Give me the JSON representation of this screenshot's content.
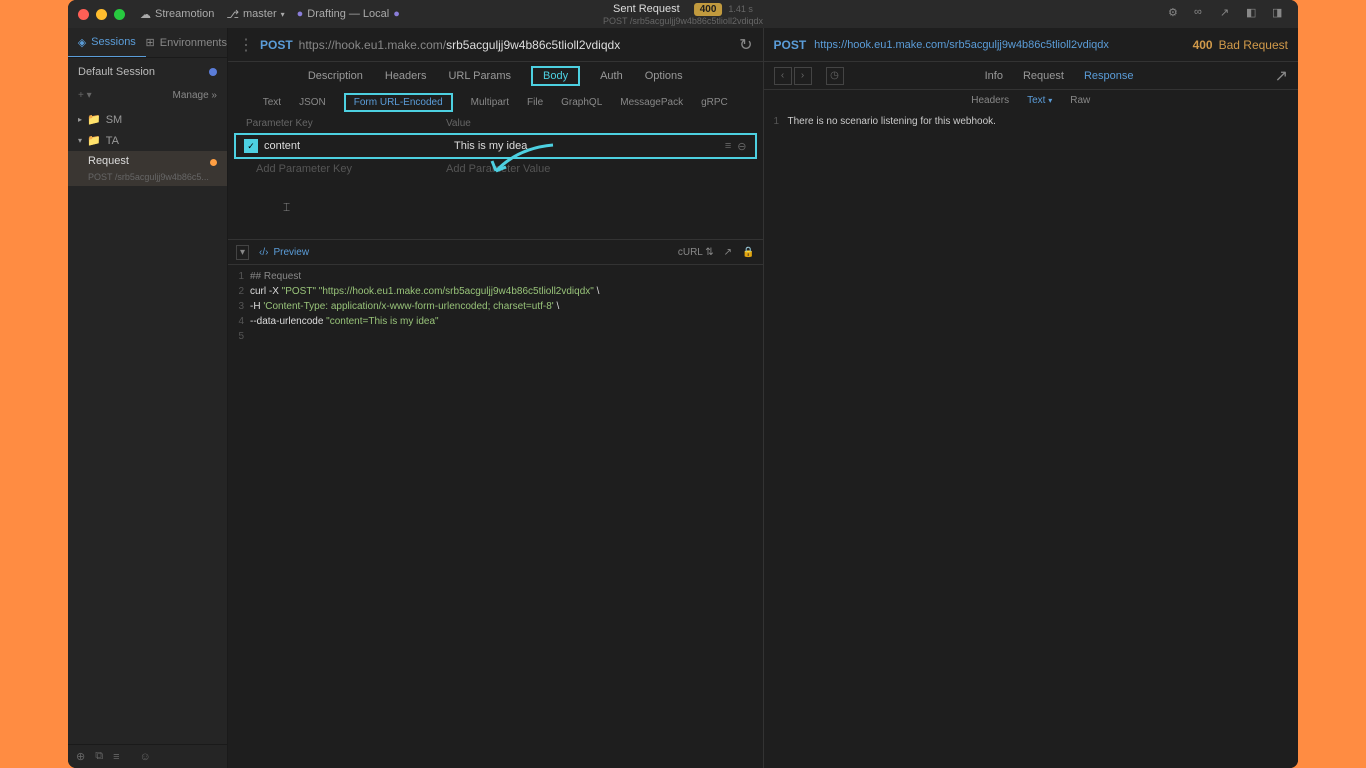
{
  "titlebar": {
    "app": "Streamotion",
    "branch": "master",
    "status": "Drafting — Local",
    "title": "Sent Request",
    "subtitle": "POST /srb5acguljj9w4b86c5tlioll2vdiqdx",
    "badge": "400",
    "time": "1.41 s"
  },
  "sidebar": {
    "tab_sessions": "Sessions",
    "tab_environments": "Environments",
    "session_label": "Default Session",
    "manage": "Manage",
    "folders": {
      "sm": "SM",
      "ta": "TA"
    },
    "request": {
      "name": "Request",
      "path": "POST /srb5acguljj9w4b86c5..."
    }
  },
  "request": {
    "method": "POST",
    "url_domain": "https://hook.eu1.make.com/",
    "url_path": "srb5acguljj9w4b86c5tlioll2vdiqdx",
    "tabs1": {
      "description": "Description",
      "headers": "Headers",
      "url_params": "URL Params",
      "body": "Body",
      "auth": "Auth",
      "options": "Options"
    },
    "tabs2": {
      "text": "Text",
      "json": "JSON",
      "form": "Form URL-Encoded",
      "multipart": "Multipart",
      "file": "File",
      "graphql": "GraphQL",
      "msgpack": "MessagePack",
      "grpc": "gRPC"
    },
    "param_header_key": "Parameter Key",
    "param_header_value": "Value",
    "params": [
      {
        "key": "content",
        "value": "This is my idea"
      }
    ],
    "placeholder_key": "Add Parameter Key",
    "placeholder_value": "Add Parameter Value"
  },
  "code": {
    "preview": "Preview",
    "export": "cURL",
    "lines": {
      "l1": "## Request",
      "l2a": "curl -X ",
      "l2b": "\"POST\"",
      "l2c": " ",
      "l2d": "\"https://hook.eu1.make.com/srb5acguljj9w4b86c5tlioll2vdiqdx\"",
      "l2e": " \\",
      "l3a": "     -H ",
      "l3b": "'Content-Type: application/x-www-form-urlencoded; charset=utf-8'",
      "l3c": " \\",
      "l4a": "     --data-urlencode ",
      "l4b": "\"content=This is my idea\""
    }
  },
  "response": {
    "method": "POST",
    "url": "https://hook.eu1.make.com/srb5acguljj9w4b86c5tlioll2vdiqdx",
    "code": "400",
    "text": "Bad Request",
    "tabs1": {
      "info": "Info",
      "request": "Request",
      "response": "Response"
    },
    "tabs2": {
      "headers": "Headers",
      "text": "Text",
      "raw": "Raw"
    },
    "body": "There is no scenario listening for this webhook."
  }
}
